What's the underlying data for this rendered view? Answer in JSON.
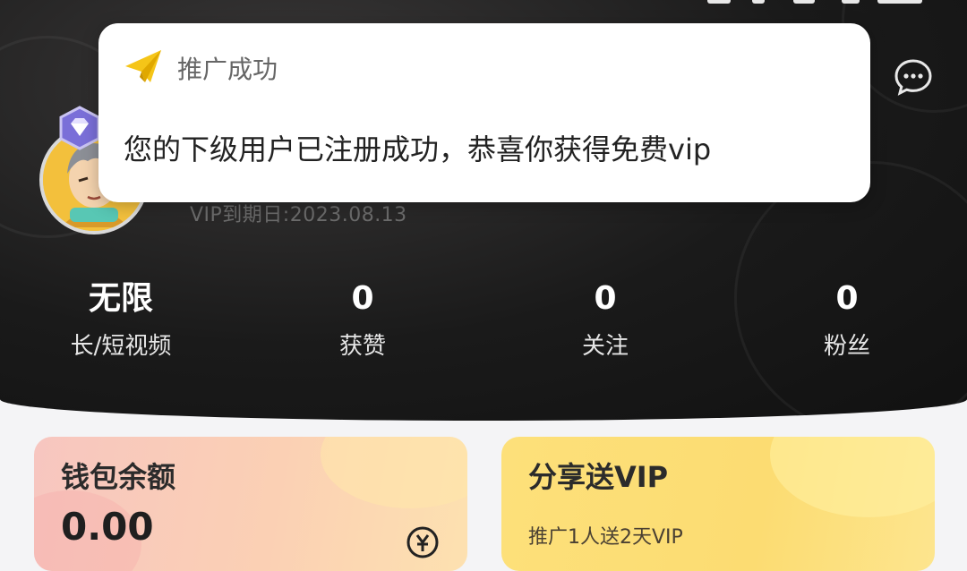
{
  "notification": {
    "title": "推广成功",
    "message": "您的下级用户已注册成功，恭喜你获得免费vip",
    "icon": "paper-plane-icon"
  },
  "profile": {
    "vip_expiry": "VIP到期日:2023.08.13"
  },
  "stats": [
    {
      "value": "无限",
      "label": "长/短视频"
    },
    {
      "value": "0",
      "label": "获赞"
    },
    {
      "value": "0",
      "label": "关注"
    },
    {
      "value": "0",
      "label": "粉丝"
    }
  ],
  "wallet_card": {
    "title": "钱包余额",
    "amount": "0.00"
  },
  "share_card": {
    "title": "分享送VIP",
    "subtitle": "推广1人送2天VIP"
  },
  "colors": {
    "header_bg": "#1a1a1a",
    "toast_icon": "#f5c518",
    "wallet_gradient_start": "#f7c6c0",
    "share_gradient_start": "#fde07a"
  }
}
